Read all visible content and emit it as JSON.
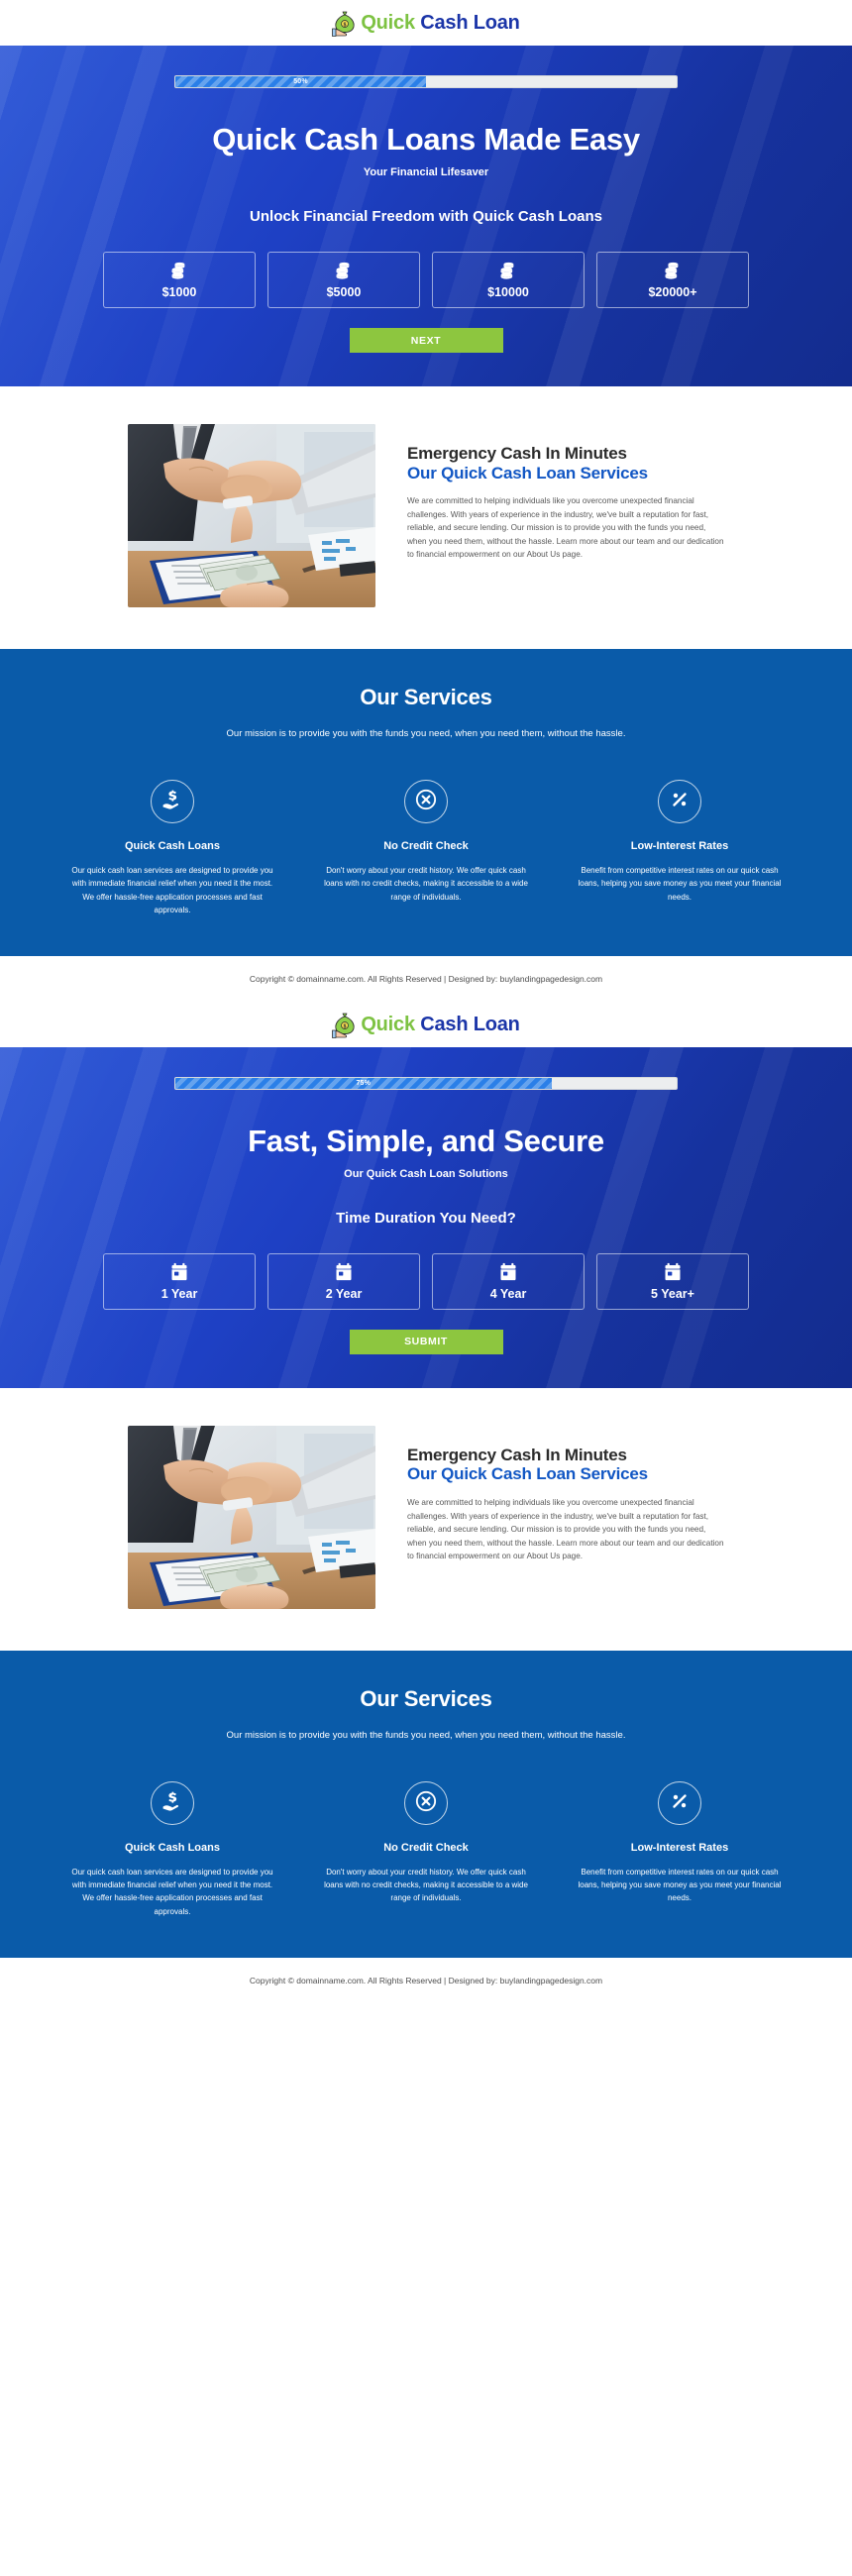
{
  "brand": {
    "name_part1": "Quick",
    "name_part2": "Cash Loan",
    "green": "#7DC242",
    "blue": "#1B35A8"
  },
  "variants": [
    {
      "progress": {
        "percent_label": "50%",
        "percent_value": 50
      },
      "title": "Quick Cash Loans Made Easy",
      "subtitle": "Your Financial Lifesaver",
      "question": "Unlock Financial Freedom with Quick Cash Loans",
      "options": [
        {
          "icon": "coin-stack-icon",
          "label": "$1000"
        },
        {
          "icon": "coin-stack-icon",
          "label": "$5000"
        },
        {
          "icon": "coin-stack-icon",
          "label": "$10000"
        },
        {
          "icon": "coin-stack-icon",
          "label": "$20000+"
        }
      ],
      "cta_label": "NEXT"
    },
    {
      "progress": {
        "percent_label": "75%",
        "percent_value": 75
      },
      "title": "Fast, Simple, and Secure",
      "subtitle": "Our Quick Cash Loan Solutions",
      "question": "Time Duration You Need?",
      "options": [
        {
          "icon": "calendar-icon",
          "label": "1 Year"
        },
        {
          "icon": "calendar-icon",
          "label": "2 Year"
        },
        {
          "icon": "calendar-icon",
          "label": "4 Year"
        },
        {
          "icon": "calendar-icon",
          "label": "5 Year+"
        }
      ],
      "cta_label": "SUBMIT"
    }
  ],
  "about": {
    "heading_dark": "Emergency Cash In Minutes",
    "heading_blue": "Our Quick Cash Loan Services",
    "paragraph": "We are committed to helping individuals like you overcome unexpected financial challenges. With years of experience in the industry, we've built a reputation for fast, reliable, and secure lending. Our mission is to provide you with the funds you need, when you need them, without the hassle. Learn more about our team and our dedication to financial empowerment on our About Us page.",
    "photo_alt": "business-handshake-with-cash-photo"
  },
  "services": {
    "title": "Our Services",
    "subtitle": "Our mission is to provide you with the funds you need, when you need them, without the hassle.",
    "items": [
      {
        "icon": "hand-holding-dollar-icon",
        "title": "Quick Cash Loans",
        "desc": "Our quick cash loan services are designed to provide you with immediate financial relief when you need it the most. We offer hassle-free application processes and fast approvals."
      },
      {
        "icon": "x-circle-icon",
        "title": "No Credit Check",
        "desc": "Don't worry about your credit history. We offer quick cash loans with no credit checks, making it accessible to a wide range of individuals."
      },
      {
        "icon": "percent-circle-icon",
        "title": "Low-Interest Rates",
        "desc": "Benefit from competitive interest rates on our quick cash loans, helping you save money as you meet your financial needs."
      }
    ]
  },
  "footer": {
    "copyright": "Copyright © domainname.com. All Rights Reserved | Designed by: buylandingpagedesign.com"
  },
  "colors": {
    "hero_blue": "#1C40BE",
    "services_blue": "#0A5BA9",
    "cta_green": "#8DC63F",
    "heading_blue": "#1257C4"
  }
}
